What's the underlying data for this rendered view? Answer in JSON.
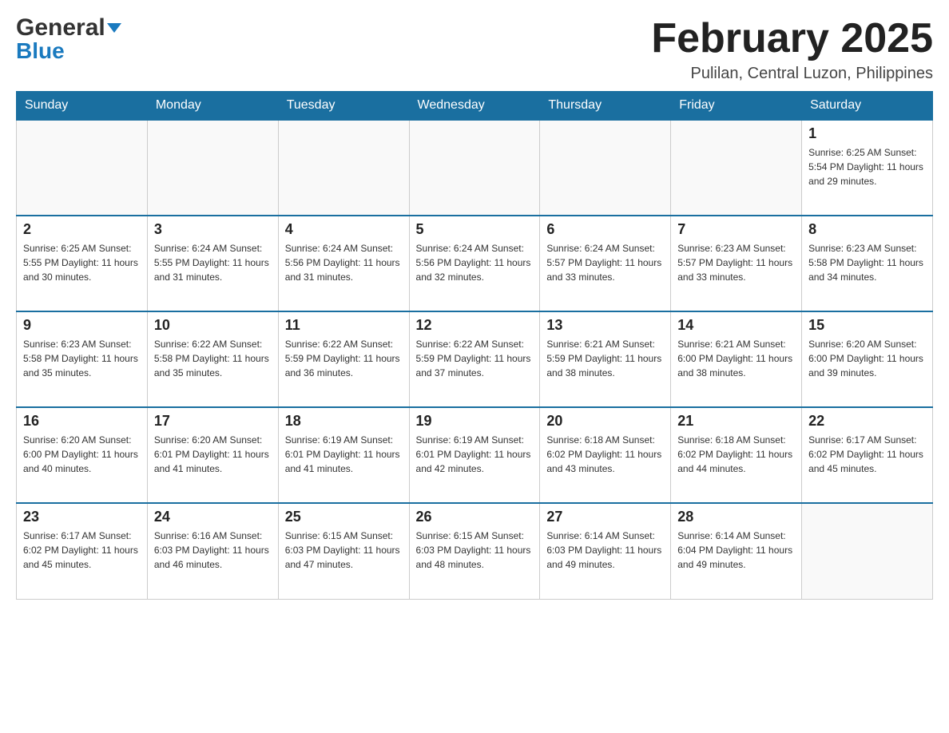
{
  "header": {
    "logo_general": "General",
    "logo_blue": "Blue",
    "month_title": "February 2025",
    "location": "Pulilan, Central Luzon, Philippines"
  },
  "calendar": {
    "days_of_week": [
      "Sunday",
      "Monday",
      "Tuesday",
      "Wednesday",
      "Thursday",
      "Friday",
      "Saturday"
    ],
    "weeks": [
      {
        "days": [
          {
            "date": "",
            "info": ""
          },
          {
            "date": "",
            "info": ""
          },
          {
            "date": "",
            "info": ""
          },
          {
            "date": "",
            "info": ""
          },
          {
            "date": "",
            "info": ""
          },
          {
            "date": "",
            "info": ""
          },
          {
            "date": "1",
            "info": "Sunrise: 6:25 AM\nSunset: 5:54 PM\nDaylight: 11 hours\nand 29 minutes."
          }
        ]
      },
      {
        "days": [
          {
            "date": "2",
            "info": "Sunrise: 6:25 AM\nSunset: 5:55 PM\nDaylight: 11 hours\nand 30 minutes."
          },
          {
            "date": "3",
            "info": "Sunrise: 6:24 AM\nSunset: 5:55 PM\nDaylight: 11 hours\nand 31 minutes."
          },
          {
            "date": "4",
            "info": "Sunrise: 6:24 AM\nSunset: 5:56 PM\nDaylight: 11 hours\nand 31 minutes."
          },
          {
            "date": "5",
            "info": "Sunrise: 6:24 AM\nSunset: 5:56 PM\nDaylight: 11 hours\nand 32 minutes."
          },
          {
            "date": "6",
            "info": "Sunrise: 6:24 AM\nSunset: 5:57 PM\nDaylight: 11 hours\nand 33 minutes."
          },
          {
            "date": "7",
            "info": "Sunrise: 6:23 AM\nSunset: 5:57 PM\nDaylight: 11 hours\nand 33 minutes."
          },
          {
            "date": "8",
            "info": "Sunrise: 6:23 AM\nSunset: 5:58 PM\nDaylight: 11 hours\nand 34 minutes."
          }
        ]
      },
      {
        "days": [
          {
            "date": "9",
            "info": "Sunrise: 6:23 AM\nSunset: 5:58 PM\nDaylight: 11 hours\nand 35 minutes."
          },
          {
            "date": "10",
            "info": "Sunrise: 6:22 AM\nSunset: 5:58 PM\nDaylight: 11 hours\nand 35 minutes."
          },
          {
            "date": "11",
            "info": "Sunrise: 6:22 AM\nSunset: 5:59 PM\nDaylight: 11 hours\nand 36 minutes."
          },
          {
            "date": "12",
            "info": "Sunrise: 6:22 AM\nSunset: 5:59 PM\nDaylight: 11 hours\nand 37 minutes."
          },
          {
            "date": "13",
            "info": "Sunrise: 6:21 AM\nSunset: 5:59 PM\nDaylight: 11 hours\nand 38 minutes."
          },
          {
            "date": "14",
            "info": "Sunrise: 6:21 AM\nSunset: 6:00 PM\nDaylight: 11 hours\nand 38 minutes."
          },
          {
            "date": "15",
            "info": "Sunrise: 6:20 AM\nSunset: 6:00 PM\nDaylight: 11 hours\nand 39 minutes."
          }
        ]
      },
      {
        "days": [
          {
            "date": "16",
            "info": "Sunrise: 6:20 AM\nSunset: 6:00 PM\nDaylight: 11 hours\nand 40 minutes."
          },
          {
            "date": "17",
            "info": "Sunrise: 6:20 AM\nSunset: 6:01 PM\nDaylight: 11 hours\nand 41 minutes."
          },
          {
            "date": "18",
            "info": "Sunrise: 6:19 AM\nSunset: 6:01 PM\nDaylight: 11 hours\nand 41 minutes."
          },
          {
            "date": "19",
            "info": "Sunrise: 6:19 AM\nSunset: 6:01 PM\nDaylight: 11 hours\nand 42 minutes."
          },
          {
            "date": "20",
            "info": "Sunrise: 6:18 AM\nSunset: 6:02 PM\nDaylight: 11 hours\nand 43 minutes."
          },
          {
            "date": "21",
            "info": "Sunrise: 6:18 AM\nSunset: 6:02 PM\nDaylight: 11 hours\nand 44 minutes."
          },
          {
            "date": "22",
            "info": "Sunrise: 6:17 AM\nSunset: 6:02 PM\nDaylight: 11 hours\nand 45 minutes."
          }
        ]
      },
      {
        "days": [
          {
            "date": "23",
            "info": "Sunrise: 6:17 AM\nSunset: 6:02 PM\nDaylight: 11 hours\nand 45 minutes."
          },
          {
            "date": "24",
            "info": "Sunrise: 6:16 AM\nSunset: 6:03 PM\nDaylight: 11 hours\nand 46 minutes."
          },
          {
            "date": "25",
            "info": "Sunrise: 6:15 AM\nSunset: 6:03 PM\nDaylight: 11 hours\nand 47 minutes."
          },
          {
            "date": "26",
            "info": "Sunrise: 6:15 AM\nSunset: 6:03 PM\nDaylight: 11 hours\nand 48 minutes."
          },
          {
            "date": "27",
            "info": "Sunrise: 6:14 AM\nSunset: 6:03 PM\nDaylight: 11 hours\nand 49 minutes."
          },
          {
            "date": "28",
            "info": "Sunrise: 6:14 AM\nSunset: 6:04 PM\nDaylight: 11 hours\nand 49 minutes."
          },
          {
            "date": "",
            "info": ""
          }
        ]
      }
    ]
  }
}
